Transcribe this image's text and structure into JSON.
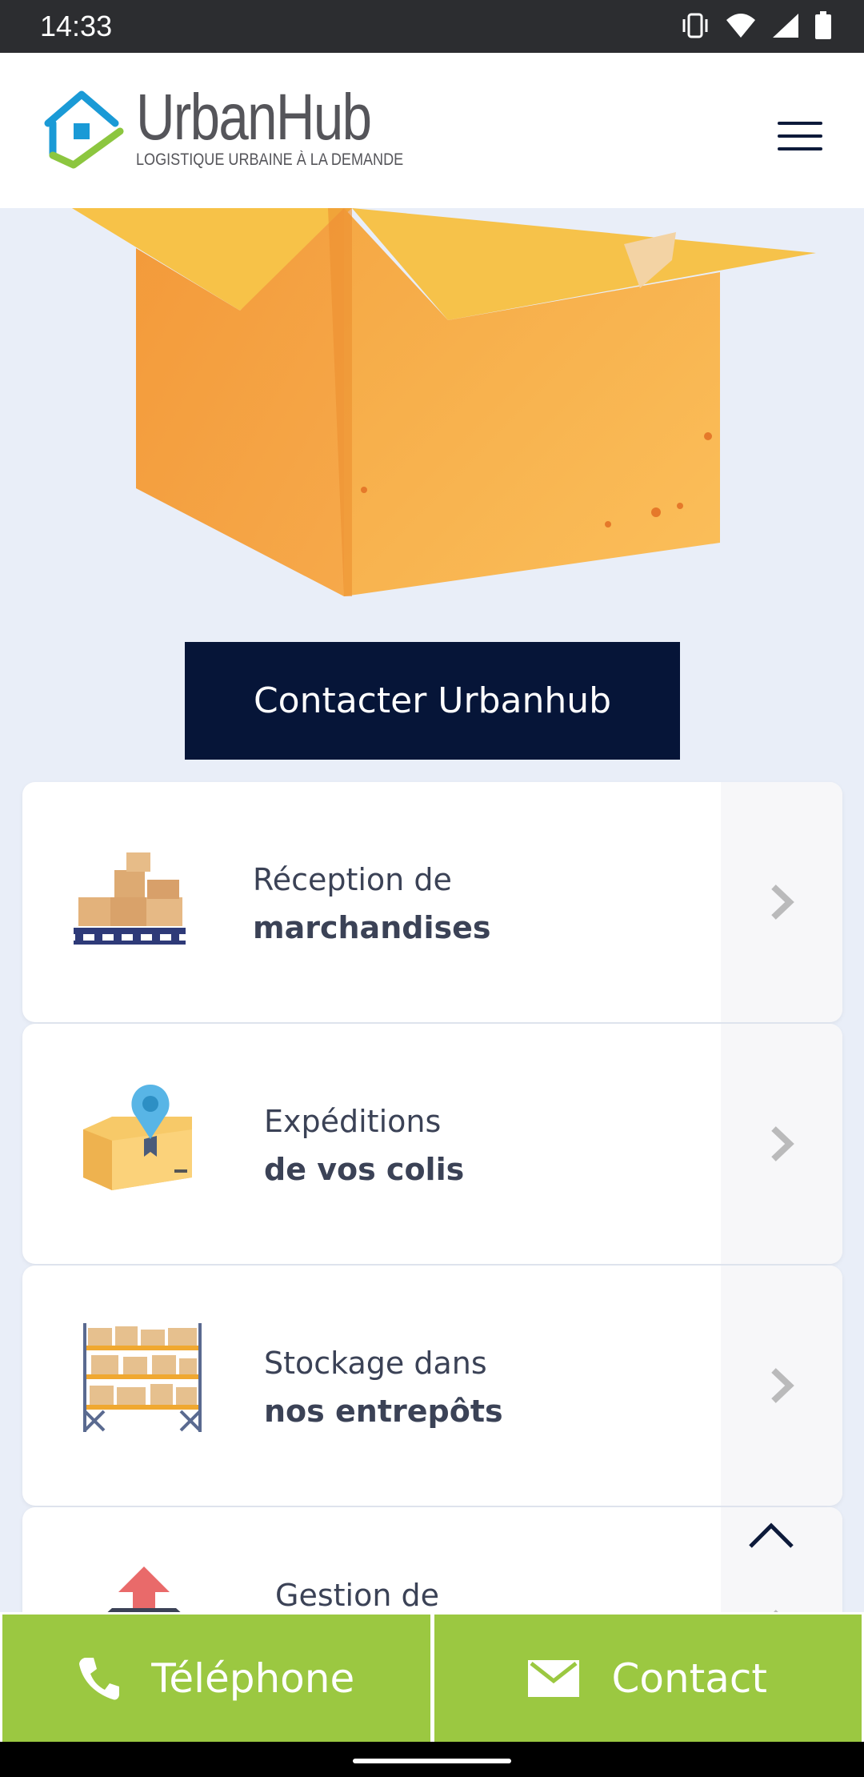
{
  "status_bar": {
    "time": "14:33",
    "icons": [
      "vibrate-icon",
      "wifi-icon",
      "signal-icon",
      "battery-icon"
    ]
  },
  "header": {
    "brand_name": "UrbanHub",
    "tagline": "LOGISTIQUE URBAINE À LA DEMANDE",
    "menu_icon": "hamburger-menu-icon"
  },
  "hero": {
    "image": "open-cardboard-box"
  },
  "cta_label": "Contacter Urbanhub",
  "services": [
    {
      "line1": "Réception de",
      "line2": "marchandises",
      "icon": "pallet-boxes-icon"
    },
    {
      "line1": "Expéditions",
      "line2": "de vos colis",
      "icon": "parcel-location-icon"
    },
    {
      "line1": "Stockage dans",
      "line2": "nos entrepôts",
      "icon": "warehouse-shelves-icon"
    },
    {
      "line1": "Gestion de",
      "line2": "",
      "icon": "stock-arrow-icon"
    }
  ],
  "bottom_bar": {
    "phone_label": "Téléphone",
    "contact_label": "Contact"
  },
  "colors": {
    "cta_background": "#061538",
    "bottom_bar": "#9bc841",
    "page_background": "#e9eef8"
  }
}
